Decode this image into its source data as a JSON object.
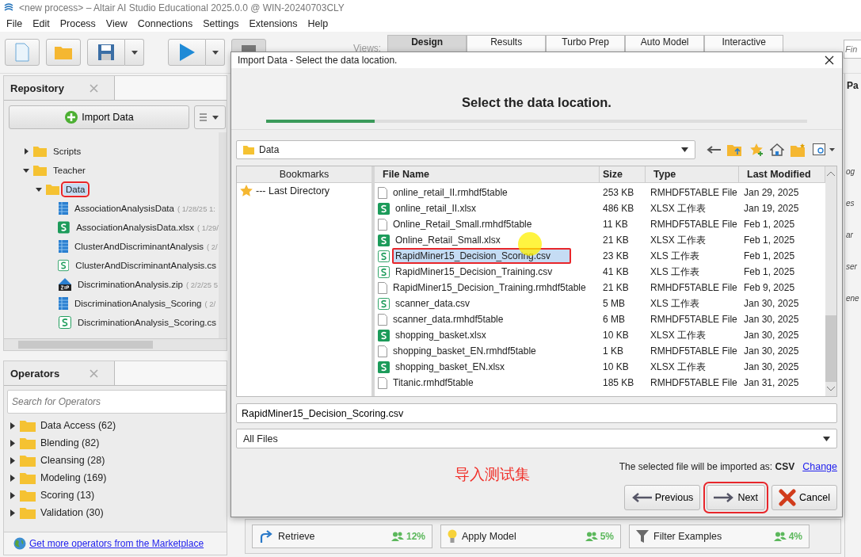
{
  "window": {
    "title": "<new process> – Altair AI Studio Educational 2025.0.0 @ WIN-20240703CLY"
  },
  "menu": [
    "File",
    "Edit",
    "Process",
    "View",
    "Connections",
    "Settings",
    "Extensions",
    "Help"
  ],
  "views": {
    "label": "Views:",
    "tabs": [
      {
        "label": "Design",
        "selected": true
      },
      {
        "label": "Results",
        "selected": false
      },
      {
        "label": "Turbo Prep",
        "selected": false
      },
      {
        "label": "Auto Model",
        "selected": false
      },
      {
        "label": "Interactive",
        "selected": false
      }
    ]
  },
  "search": {
    "placeholder": "Fin"
  },
  "repository": {
    "title": "Repository",
    "import_button": "Import Data",
    "tree": [
      {
        "label": "Scripts",
        "kind": "folder",
        "expanded": false
      },
      {
        "label": "Teacher",
        "kind": "folder",
        "expanded": true,
        "children": [
          {
            "label": "Data",
            "kind": "folder",
            "expanded": true,
            "selected": true,
            "annotated": true,
            "children": [
              {
                "label": "AssociationAnalysisData",
                "meta": "( 1/28/25 1:",
                "kind": "table"
              },
              {
                "label": "AssociationAnalysisData.xlsx",
                "meta": "( 1/29/",
                "kind": "sheet"
              },
              {
                "label": "ClusterAndDiscriminantAnalysis",
                "meta": "( 2/",
                "kind": "table"
              },
              {
                "label": "ClusterAndDiscriminantAnalysis.cs",
                "kind": "csv"
              },
              {
                "label": "DiscriminationAnalysis.zip",
                "meta": "( 2/2/25 5",
                "kind": "zip"
              },
              {
                "label": "DiscriminationAnalysis_Scoring",
                "meta": "( 2/",
                "kind": "table"
              },
              {
                "label": "DiscriminationAnalysis_Scoring.cs",
                "kind": "csv"
              }
            ]
          }
        ]
      }
    ]
  },
  "operators": {
    "title": "Operators",
    "placeholder": "Search for Operators",
    "groups": [
      "Data Access (62)",
      "Blending (82)",
      "Cleansing (28)",
      "Modeling (169)",
      "Scoring (13)",
      "Validation (30)"
    ],
    "marketplace_link": "Get more operators from the Marketplace"
  },
  "recommended": [
    {
      "label": "Retrieve",
      "share": "12%",
      "kind": "retrieve"
    },
    {
      "label": "Apply Model",
      "share": "5%",
      "kind": "bulb"
    },
    {
      "label": "Filter Examples",
      "share": "4%",
      "kind": "filter"
    }
  ],
  "right_panel": {
    "title": "Pa",
    "items": [
      "og",
      "es",
      "ar",
      "ser",
      "ene"
    ]
  },
  "dialog": {
    "title": "Import Data - Select the data location.",
    "heading": "Select the data location.",
    "progress": {
      "level": 0.2
    },
    "location": "Data",
    "bookmarks": {
      "title": "Bookmarks",
      "items": [
        "--- Last Directory"
      ]
    },
    "columns": [
      "File Name",
      "Size",
      "Type",
      "Last Modified"
    ],
    "files": [
      {
        "name": "online_retail_II.rmhdf5table",
        "kind": "data",
        "size": "253 KB",
        "type": "RMHDF5TABLE File",
        "modified": "Jan 29, 2025",
        "selected": false
      },
      {
        "name": "online_retail_II.xlsx",
        "kind": "sheet",
        "size": "486 KB",
        "type": "XLSX 工作表",
        "modified": "Jan 19, 2025",
        "selected": false
      },
      {
        "name": "Online_Retail_Small.rmhdf5table",
        "kind": "data",
        "size": "11 KB",
        "type": "RMHDF5TABLE File",
        "modified": "Feb 1, 2025",
        "selected": false
      },
      {
        "name": "Online_Retail_Small.xlsx",
        "kind": "sheet",
        "size": "21 KB",
        "type": "XLSX 工作表",
        "modified": "Feb 1, 2025",
        "selected": false
      },
      {
        "name": "RapidMiner15_Decision_Scoring.csv",
        "kind": "csv",
        "size": "23 KB",
        "type": "XLS 工作表",
        "modified": "Feb 1, 2025",
        "selected": true,
        "annotated": true
      },
      {
        "name": "RapidMiner15_Decision_Training.csv",
        "kind": "csv",
        "size": "41 KB",
        "type": "XLS 工作表",
        "modified": "Feb 1, 2025",
        "selected": false
      },
      {
        "name": "RapidMiner15_Decision_Training.rmhdf5table",
        "kind": "data",
        "size": "21 KB",
        "type": "RMHDF5TABLE File",
        "modified": "Feb 9, 2025",
        "selected": false
      },
      {
        "name": "scanner_data.csv",
        "kind": "csv",
        "size": "5 MB",
        "type": "XLS 工作表",
        "modified": "Jan 30, 2025",
        "selected": false
      },
      {
        "name": "scanner_data.rmhdf5table",
        "kind": "data",
        "size": "6 MB",
        "type": "RMHDF5TABLE File",
        "modified": "Jan 30, 2025",
        "selected": false
      },
      {
        "name": "shopping_basket.xlsx",
        "kind": "sheet",
        "size": "10 KB",
        "type": "XLSX 工作表",
        "modified": "Jan 30, 2025",
        "selected": false
      },
      {
        "name": "shopping_basket_EN.rmhdf5table",
        "kind": "data",
        "size": "1 KB",
        "type": "RMHDF5TABLE File",
        "modified": "Jan 30, 2025",
        "selected": false
      },
      {
        "name": "shopping_basket_EN.xlsx",
        "kind": "sheet",
        "size": "10 KB",
        "type": "XLSX 工作表",
        "modified": "Jan 30, 2025",
        "selected": false
      },
      {
        "name": "Titanic.rmhdf5table",
        "kind": "data",
        "size": "185 KB",
        "type": "RMHDF5TABLE File",
        "modified": "Jan 31, 2025",
        "selected": false
      }
    ],
    "filename": "RapidMiner15_Decision_Scoring.csv",
    "filter": "All Files",
    "import_note": "The selected file will be imported as: **CSV**",
    "change_link": "Change",
    "annotation": "导入测试集",
    "buttons": [
      {
        "label": "Previous",
        "kind": "previous",
        "annotated": false
      },
      {
        "label": "Next",
        "kind": "next",
        "annotated": true
      },
      {
        "label": "Cancel",
        "kind": "cancel",
        "annotated": false
      }
    ]
  }
}
